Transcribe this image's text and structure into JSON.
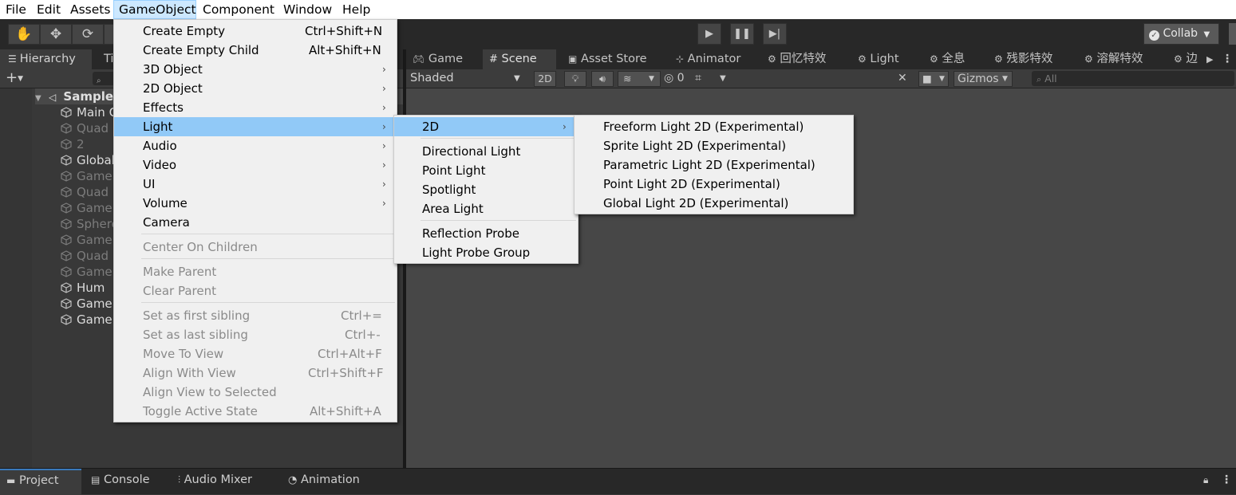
{
  "menubar": [
    "File",
    "Edit",
    "Assets",
    "GameObject",
    "Component",
    "Window",
    "Help"
  ],
  "toolbar": {
    "collab_label": "Collab"
  },
  "hierarchy": {
    "tab_label": "Hierarchy",
    "next_tab_label": "Ti",
    "root_label": "SampleS",
    "items": [
      "Main C",
      "Quad",
      "2",
      "Global",
      "Game",
      "Quad",
      "Game",
      "Sphere",
      "Game",
      "Quad",
      "Game",
      "Hum",
      "Game",
      "Game"
    ]
  },
  "scene_tabs": [
    "Game",
    "Scene",
    "Asset Store",
    "Animator",
    "回忆特效",
    "Light",
    "全息",
    "残影特效",
    "溶解特效",
    "边"
  ],
  "scene_toolbar": {
    "shading": "Shaded",
    "mode_2d": "2D",
    "hidden_count": "0",
    "gizmos": "Gizmos",
    "search_placeholder": "All"
  },
  "bottom_tabs": [
    "Project",
    "Console",
    "Audio Mixer",
    "Animation"
  ],
  "gameobject_menu": {
    "items": [
      {
        "label": "Create Empty",
        "shortcut": "Ctrl+Shift+N"
      },
      {
        "label": "Create Empty Child",
        "shortcut": "Alt+Shift+N"
      },
      {
        "label": "3D Object"
      },
      {
        "label": "2D Object"
      },
      {
        "label": "Effects"
      },
      {
        "label": "Light"
      },
      {
        "label": "Audio"
      },
      {
        "label": "Video"
      },
      {
        "label": "UI"
      },
      {
        "label": "Volume"
      },
      {
        "label": "Camera"
      },
      {
        "label": "Center On Children"
      },
      {
        "label": "Make Parent"
      },
      {
        "label": "Clear Parent"
      },
      {
        "label": "Set as first sibling",
        "shortcut": "Ctrl+="
      },
      {
        "label": "Set as last sibling",
        "shortcut": "Ctrl+-"
      },
      {
        "label": "Move To View",
        "shortcut": "Ctrl+Alt+F"
      },
      {
        "label": "Align With View",
        "shortcut": "Ctrl+Shift+F"
      },
      {
        "label": "Align View to Selected"
      },
      {
        "label": "Toggle Active State",
        "shortcut": "Alt+Shift+A"
      }
    ]
  },
  "light_menu": {
    "items": [
      "2D",
      "Directional Light",
      "Point Light",
      "Spotlight",
      "Area Light",
      "Reflection Probe",
      "Light Probe Group"
    ]
  },
  "light2d_menu": {
    "items": [
      "Freeform Light 2D (Experimental)",
      "Sprite Light 2D (Experimental)",
      "Parametric Light 2D (Experimental)",
      "Point Light 2D (Experimental)",
      "Global Light 2D (Experimental)"
    ]
  },
  "colors": {
    "highlight": "#91c9f7",
    "menu_bg": "#f0f0f0",
    "editor_dark": "#383838",
    "scene_bg": "#474747"
  }
}
